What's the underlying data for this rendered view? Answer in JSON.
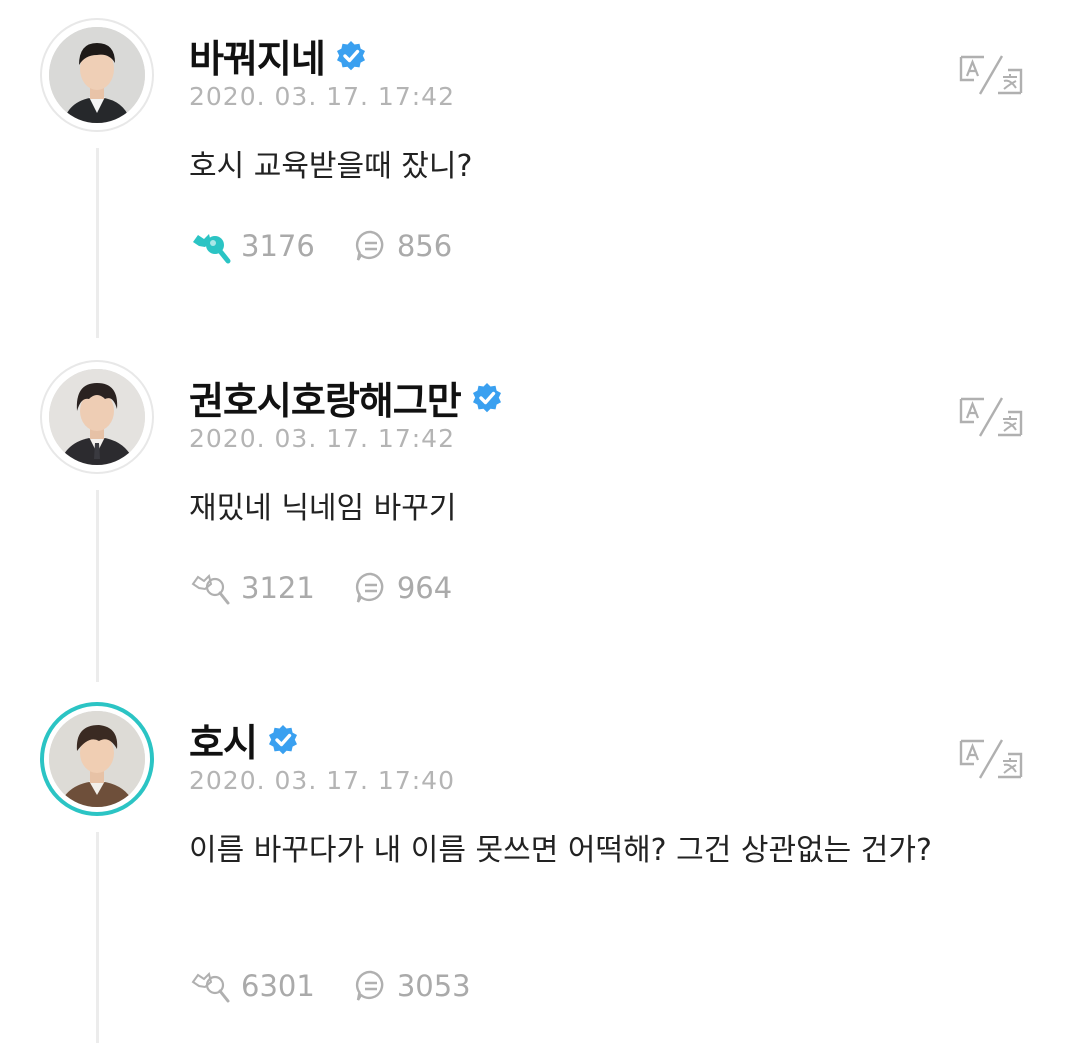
{
  "posts": [
    {
      "name": "바꿔지네",
      "date": "2020. 03. 17. 17:42",
      "text": "호시 교육받을때 잤니?",
      "likes": "3176",
      "comments": "856",
      "liked": true,
      "active": false
    },
    {
      "name": "권호시호랑해그만",
      "date": "2020. 03. 17. 17:42",
      "text": "재밌네 닉네임 바꾸기",
      "likes": "3121",
      "comments": "964",
      "liked": false,
      "active": false
    },
    {
      "name": "호시",
      "date": "2020. 03. 17. 17:40",
      "text": "이름 바꾸다가 내 이름 못쓰면 어떡해? 그건 상관없는 건가?",
      "likes": "6301",
      "comments": "3053",
      "liked": false,
      "active": true
    }
  ],
  "colors": {
    "verified": "#3aa0f0",
    "liked_icon": "#2bc4c4",
    "active_ring": "#2bc4c4",
    "muted": "#b4b4b4"
  }
}
